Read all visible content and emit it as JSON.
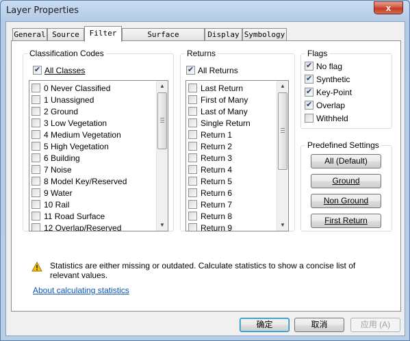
{
  "window": {
    "title": "Layer Properties",
    "close_glyph": "x"
  },
  "tabs": [
    {
      "label": "General"
    },
    {
      "label": "Source"
    },
    {
      "label": "Filter"
    },
    {
      "label": "Surface Constraints"
    },
    {
      "label": "Display"
    },
    {
      "label": "Symbology"
    }
  ],
  "classification": {
    "legend": "Classification Codes",
    "all_label": "All Classes",
    "all_checked": true,
    "items": [
      {
        "label": "0  Never Classified",
        "checked": false
      },
      {
        "label": "1  Unassigned",
        "checked": false
      },
      {
        "label": "2  Ground",
        "checked": false
      },
      {
        "label": "3  Low Vegetation",
        "checked": false
      },
      {
        "label": "4  Medium Vegetation",
        "checked": false
      },
      {
        "label": "5  High Vegetation",
        "checked": false
      },
      {
        "label": "6  Building",
        "checked": false
      },
      {
        "label": "7  Noise",
        "checked": false
      },
      {
        "label": "8  Model Key/Reserved",
        "checked": false
      },
      {
        "label": "9  Water",
        "checked": false
      },
      {
        "label": "10  Rail",
        "checked": false
      },
      {
        "label": "11  Road Surface",
        "checked": false
      },
      {
        "label": "12  Overlap/Reserved",
        "checked": false
      }
    ]
  },
  "returns": {
    "legend": "Returns",
    "all_label": "All Returns",
    "all_checked": true,
    "items": [
      {
        "label": "Last Return",
        "checked": false
      },
      {
        "label": "First of Many",
        "checked": false
      },
      {
        "label": "Last of Many",
        "checked": false
      },
      {
        "label": "Single Return",
        "checked": false
      },
      {
        "label": "Return 1",
        "checked": false
      },
      {
        "label": "Return 2",
        "checked": false
      },
      {
        "label": "Return 3",
        "checked": false
      },
      {
        "label": "Return 4",
        "checked": false
      },
      {
        "label": "Return 5",
        "checked": false
      },
      {
        "label": "Return 6",
        "checked": false
      },
      {
        "label": "Return 7",
        "checked": false
      },
      {
        "label": "Return 8",
        "checked": false
      },
      {
        "label": "Return 9",
        "checked": false
      }
    ]
  },
  "flags": {
    "legend": "Flags",
    "items": [
      {
        "label": "No flag",
        "checked": true
      },
      {
        "label": "Synthetic",
        "checked": true
      },
      {
        "label": "Key-Point",
        "checked": true
      },
      {
        "label": "Overlap",
        "checked": true
      },
      {
        "label": "Withheld",
        "checked": false
      }
    ]
  },
  "predefined": {
    "legend": "Predefined Settings",
    "buttons": [
      "All (Default)",
      "Ground",
      "Non Ground",
      "First Return"
    ]
  },
  "message": {
    "icon": "warning-icon",
    "text": "Statistics are either missing or outdated.  Calculate statistics to show a concise list of relevant values.",
    "link": "About calculating statistics"
  },
  "footer": {
    "ok_label": "确定",
    "cancel_label": "取消",
    "apply_label": "应用 (A)"
  },
  "colors": {
    "link": "#0b55b6",
    "warning": "#f2c200",
    "check": "#1f3d7a"
  }
}
